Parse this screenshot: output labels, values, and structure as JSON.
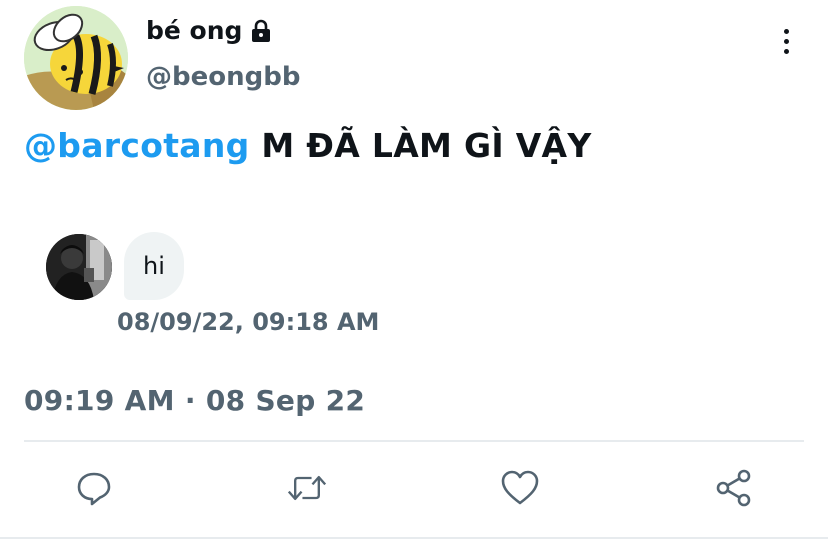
{
  "author": {
    "display_name": "bé ong",
    "handle": "@beongbb",
    "avatar_icon": "bee-avatar",
    "lock_icon": "lock-icon"
  },
  "tweet": {
    "mention": "@barcotang",
    "text": "M ĐÃ LÀM GÌ VẬY",
    "timestamp": "09:19 AM · 08 Sep 22"
  },
  "quoted_message": {
    "text": "hi",
    "time": "08/09/22, 09:18 AM",
    "avatar_icon": "person-photo-avatar"
  },
  "actions": [
    {
      "name": "reply",
      "icon": "comment-icon"
    },
    {
      "name": "retweet",
      "icon": "retweet-icon"
    },
    {
      "name": "like",
      "icon": "heart-icon"
    },
    {
      "name": "share",
      "icon": "share-icon"
    }
  ],
  "colors": {
    "accent": "#1d9bf0",
    "text_primary": "#0f1419",
    "text_secondary": "#536471",
    "bubble": "#eff3f4",
    "divider": "#e7ebee"
  }
}
